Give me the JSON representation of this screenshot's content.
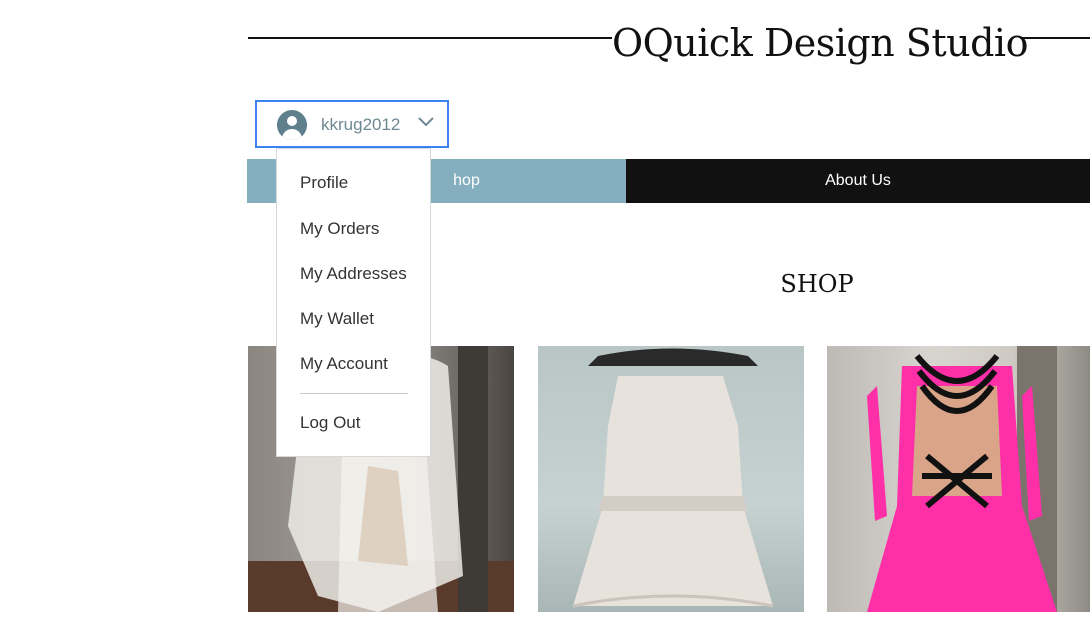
{
  "header": {
    "site_title": "OQuick Design Studio"
  },
  "account_menu": {
    "username": "kkrug2012",
    "items": [
      {
        "label": "Profile"
      },
      {
        "label": "My Orders"
      },
      {
        "label": "My Addresses"
      },
      {
        "label": "My Wallet"
      },
      {
        "label": "My Account"
      }
    ],
    "logout_label": "Log Out"
  },
  "nav": {
    "items": [
      {
        "label": "hop"
      },
      {
        "label": "About Us"
      }
    ]
  },
  "main": {
    "section_title": "SHOP"
  },
  "colors": {
    "accent_border": "#3b82f6",
    "nav_shop_bg": "#85aebf",
    "nav_about_bg": "#111111",
    "avatar": "#5f7f8c"
  },
  "icons": {
    "avatar": "user-avatar-icon",
    "chevron": "chevron-down-icon"
  }
}
